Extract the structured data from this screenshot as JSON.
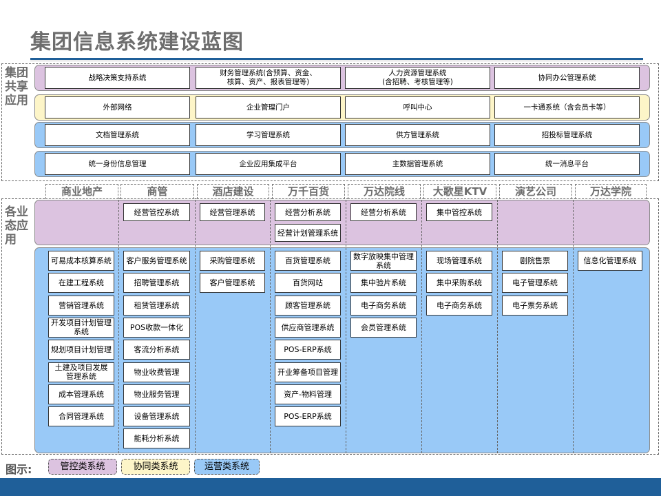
{
  "title": "集团信息系统建设蓝图",
  "shared": {
    "label": "集团\n共享\n应用",
    "rows": [
      [
        "战略决策支持系统",
        "财务管理系统(含预算、资金、\n核算、资产、报表管理等)",
        "人力资源管理系统\n(含招聘、考核管理等)",
        "协同办公管理系统"
      ],
      [
        "外部网络",
        "企业管理门户",
        "呼叫中心",
        "一卡通系统（含会员卡等）"
      ],
      [
        "文档管理系统",
        "学习管理系统",
        "供方管理系统",
        "招投标管理系统"
      ],
      [
        "统一身份信息管理",
        "企业应用集成平台",
        "主数据管理系统",
        "统一消息平台"
      ]
    ]
  },
  "business": {
    "label": "各业\n态应\n用",
    "columns": [
      "商业地产",
      "商管",
      "酒店建设",
      "万千百货",
      "万达院线",
      "大歌星KTV",
      "演艺公司",
      "万达学院"
    ],
    "control": [
      [],
      [
        "经营管控系统"
      ],
      [
        "经营管理系统"
      ],
      [
        "经营分析系统",
        "经营计划管理系统"
      ],
      [
        "经营分析系统"
      ],
      [
        "集中管控系统"
      ],
      [],
      []
    ],
    "operation": [
      [
        "可易成本核算系统",
        "在建工程系统",
        "营销管理系统",
        "开发项目计划管理\n系统",
        "规划项目计划管理",
        "土建及项目发展\n管理系统",
        "成本管理系统",
        "合同管理系统"
      ],
      [
        "客户服务管理系统",
        "招聘管理系统",
        "租赁管理系统",
        "POS收款一体化",
        "客流分析系统",
        "物业收费管理",
        "物业服务管理",
        "设备管理系统",
        "能耗分析系统"
      ],
      [
        "采购管理系统",
        "客户管理系统"
      ],
      [
        "百货管理系统",
        "百货网站",
        "顾客管理系统",
        "供应商管理系统",
        "POS-ERP系统",
        "开业筹备项目管理",
        "资产-物料管理",
        "POS-ERP系统"
      ],
      [
        "数字放映集中管理\n系统",
        "集中验片系统",
        "电子商务系统",
        "会员管理系统"
      ],
      [
        "现场管理系统",
        "集中采购系统",
        "电子商务系统"
      ],
      [
        "剧院售票",
        "电子管理系统",
        "电子票务系统"
      ],
      [
        "信息化管理系统"
      ]
    ]
  },
  "legend": {
    "label": "图示:",
    "items": [
      "管控类系统",
      "协同类系统",
      "运营类系统"
    ],
    "colors": [
      "#dcc3e0",
      "#fdf5c8",
      "#99c9f7"
    ]
  },
  "colors": {
    "accent": "#1f5f99",
    "purple": "#dcc3e0",
    "yellow": "#fdf5c8",
    "blue": "#99c9f7"
  }
}
